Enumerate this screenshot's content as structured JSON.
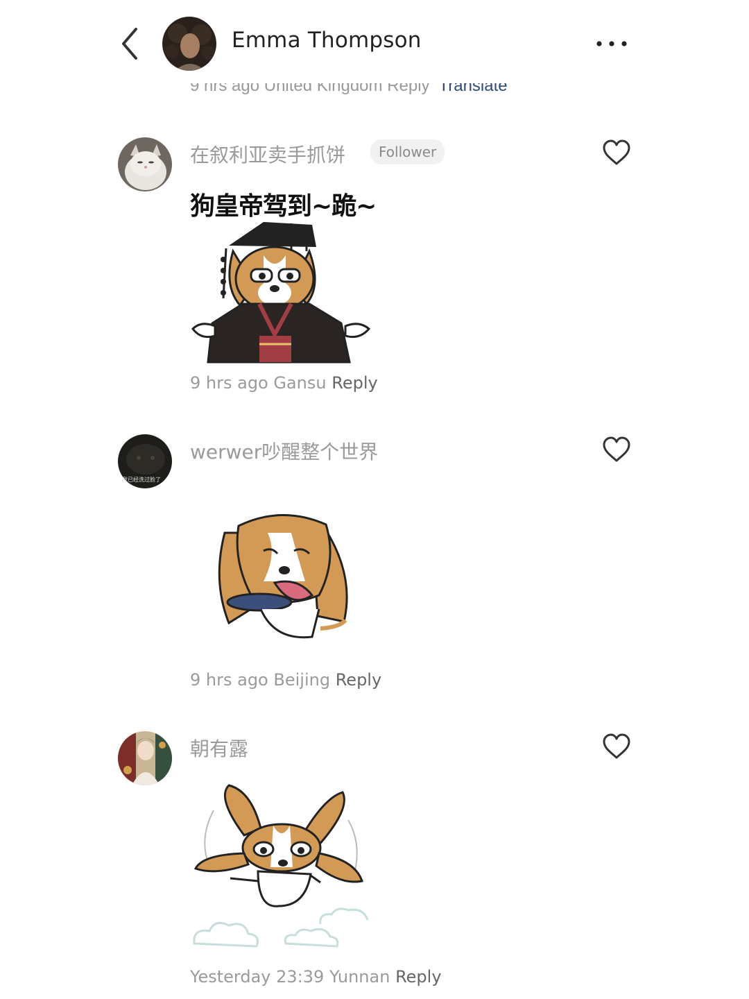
{
  "header": {
    "title": "Emma Thompson",
    "back_icon": "chevron-left-icon",
    "more_icon": "more-horizontal-icon"
  },
  "previous_comment_meta": {
    "time": "9 hrs ago",
    "location": "United Kingdom",
    "reply_label": "Reply",
    "translate_label": "Translate"
  },
  "comments": [
    {
      "username": "在叙利亚卖手抓饼",
      "badge": "Follower",
      "sticker_caption": "狗皇帝驾到~跪~",
      "time": "9 hrs ago",
      "location": "Gansu",
      "reply_label": "Reply"
    },
    {
      "username": "werwer吵醒整个世界",
      "avatar_caption": "我已经洗过脸了",
      "time": "9 hrs ago",
      "location": "Beijing",
      "reply_label": "Reply"
    },
    {
      "username": "朝有露",
      "time": "Yesterday 23:39",
      "location": "Yunnan",
      "reply_label": "Reply"
    }
  ],
  "colors": {
    "dog_tan": "#d29a55",
    "text_gray": "#9a9a9a",
    "translate_blue": "#2f4a7c"
  }
}
